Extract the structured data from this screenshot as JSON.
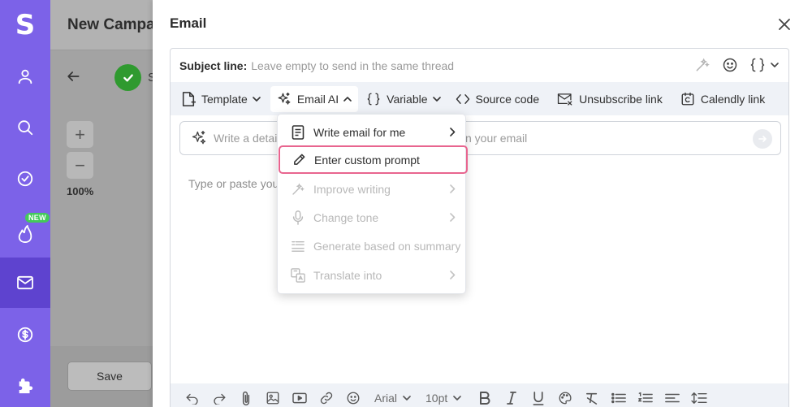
{
  "sidebar": {
    "logo": "S",
    "new_badge": "NEW",
    "items": [
      "user-icon",
      "search-icon",
      "check-circle-icon",
      "flame-icon",
      "mail-icon",
      "dollar-icon",
      "puzzle-icon"
    ],
    "accent_color": "#7c62e8",
    "active_color": "#5e43cf"
  },
  "background_page": {
    "title": "New Campai",
    "step_letter": "S",
    "zoom_in": "+",
    "zoom_out": "−",
    "zoom_level": "100%",
    "save_label": "Save"
  },
  "drawer": {
    "title": "Email",
    "subject": {
      "label": "Subject line:",
      "placeholder": "Leave empty to send in the same thread"
    },
    "toolbar": {
      "template": "Template",
      "email_ai": "Email AI",
      "variable": "Variable",
      "source_code": "Source code",
      "unsubscribe": "Unsubscribe link",
      "calendly": "Calendly link"
    },
    "ai_prompt": {
      "left_text": "Write a detaile",
      "right_text": "n your email"
    },
    "body_placeholder": "Type or paste your",
    "bottom_toolbar": {
      "font": "Arial",
      "size": "10pt"
    }
  },
  "ai_menu": {
    "items": [
      {
        "label": "Write email for me",
        "enabled": true,
        "submenu": true
      },
      {
        "label": "Enter custom prompt",
        "enabled": true,
        "submenu": false,
        "highlighted": true
      },
      {
        "label": "Improve writing",
        "enabled": false,
        "submenu": true
      },
      {
        "label": "Change tone",
        "enabled": false,
        "submenu": true
      },
      {
        "label": "Generate based on summary",
        "enabled": false,
        "submenu": false
      },
      {
        "label": "Translate into",
        "enabled": false,
        "submenu": true
      }
    ],
    "highlight_color": "#e8658f"
  }
}
